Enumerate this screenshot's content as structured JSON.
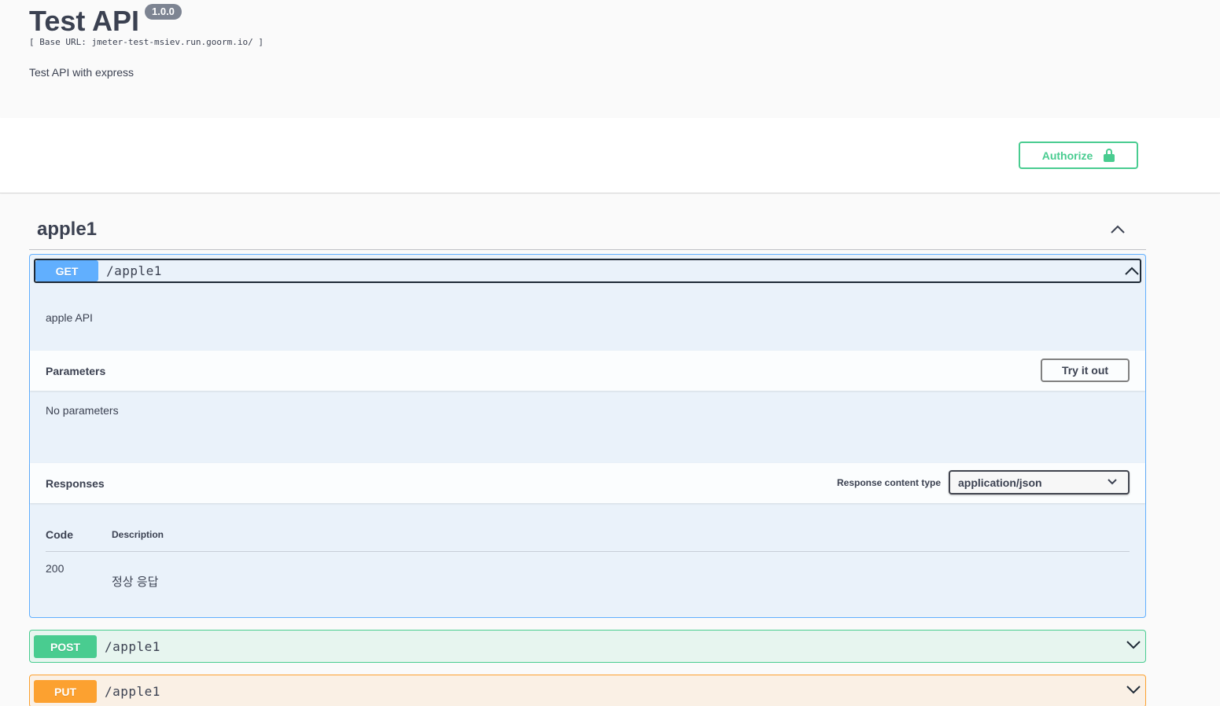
{
  "info": {
    "title": "Test API",
    "version": "1.0.0",
    "base_url": "[ Base URL: jmeter-test-msiev.run.goorm.io/ ]",
    "description": "Test API with express"
  },
  "auth": {
    "authorize_label": "Authorize"
  },
  "tag": {
    "name": "apple1"
  },
  "operations": [
    {
      "method": "GET",
      "path": "/apple1",
      "expanded": true,
      "description": "apple API",
      "parameters_title": "Parameters",
      "try_label": "Try it out",
      "no_params": "No parameters",
      "responses_title": "Responses",
      "response_content_type_label": "Response content type",
      "response_content_type": "application/json",
      "col_code": "Code",
      "col_description": "Description",
      "responses": [
        {
          "code": "200",
          "description": "정상 응답"
        }
      ]
    },
    {
      "method": "POST",
      "path": "/apple1",
      "expanded": false
    },
    {
      "method": "PUT",
      "path": "/apple1",
      "expanded": false
    }
  ],
  "colors": {
    "get": "#61affe",
    "post": "#49cc90",
    "put": "#fca130",
    "authorize": "#49cc90"
  }
}
